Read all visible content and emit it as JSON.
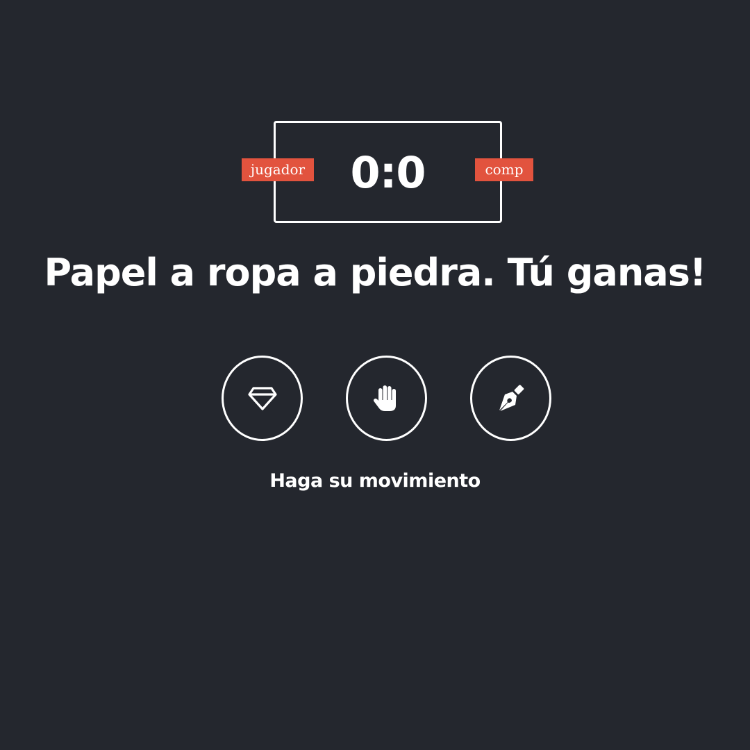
{
  "scoreboard": {
    "score": "0:0",
    "player_label": "jugador",
    "computer_label": "comp"
  },
  "result_message": "Papel a ropa a piedra. Tú ganas!",
  "choices": [
    {
      "name": "rock",
      "icon": "gem-icon"
    },
    {
      "name": "paper",
      "icon": "hand-icon"
    },
    {
      "name": "scissors",
      "icon": "pen-nib-icon"
    }
  ],
  "prompt": "Haga su movimiento",
  "colors": {
    "background": "#24272e",
    "foreground": "#ffffff",
    "accent": "#e2533e"
  }
}
